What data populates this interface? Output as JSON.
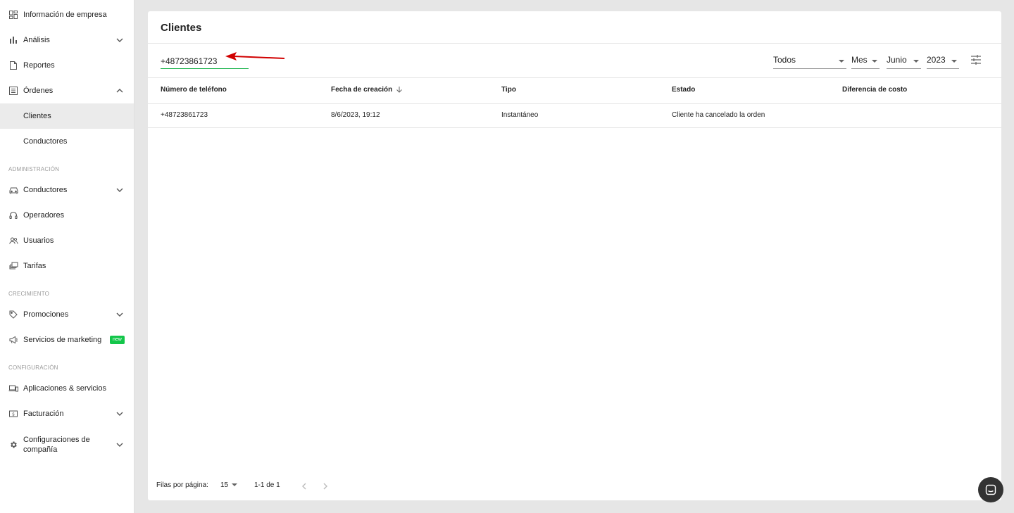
{
  "sidebar": {
    "items": [
      {
        "label": "Información de empresa",
        "icon": "dashboard-icon"
      },
      {
        "label": "Análisis",
        "icon": "bar-chart-icon"
      },
      {
        "label": "Reportes",
        "icon": "report-icon"
      },
      {
        "label": "Órdenes",
        "icon": "orders-icon"
      },
      {
        "label": "Clientes"
      },
      {
        "label": "Conductores"
      }
    ],
    "sections": {
      "admin": "ADMINISTRACIÓN",
      "growth": "CRECIMIENTO",
      "config": "CONFIGURACIÓN"
    },
    "admin_items": [
      {
        "label": "Conductores",
        "icon": "car-icon"
      },
      {
        "label": "Operadores",
        "icon": "headset-icon"
      },
      {
        "label": "Usuarios",
        "icon": "users-icon"
      },
      {
        "label": "Tarifas",
        "icon": "tariffs-icon"
      }
    ],
    "growth_items": [
      {
        "label": "Promociones",
        "icon": "tag-icon"
      },
      {
        "label": "Servicios de marketing",
        "icon": "megaphone-icon",
        "badge": "new"
      }
    ],
    "config_items": [
      {
        "label": "Aplicaciones & servicios",
        "icon": "devices-icon"
      },
      {
        "label": "Facturación",
        "icon": "billing-icon"
      },
      {
        "label": "Configuraciones de compañía",
        "icon": "gear-icon"
      }
    ],
    "badge_color": "#13c64a"
  },
  "main": {
    "title": "Clientes",
    "search_value": "+48723861723",
    "filters": {
      "type": "Todos",
      "period": "Mes",
      "month": "Junio",
      "year": "2023"
    },
    "table": {
      "columns": [
        "Número de teléfono",
        "Fecha de creación",
        "Tipo",
        "Estado",
        "Diferencia de costo"
      ],
      "rows": [
        [
          "+48723861723",
          "8/6/2023, 19:12",
          "Instantáneo",
          "Cliente ha cancelado la orden",
          ""
        ]
      ]
    },
    "footer": {
      "rows_per_page_label": "Filas por página:",
      "rows_per_page_value": "15",
      "range": "1-1 de 1"
    }
  },
  "colors": {
    "accent": "#19b34b",
    "arrow": "#d10000"
  }
}
